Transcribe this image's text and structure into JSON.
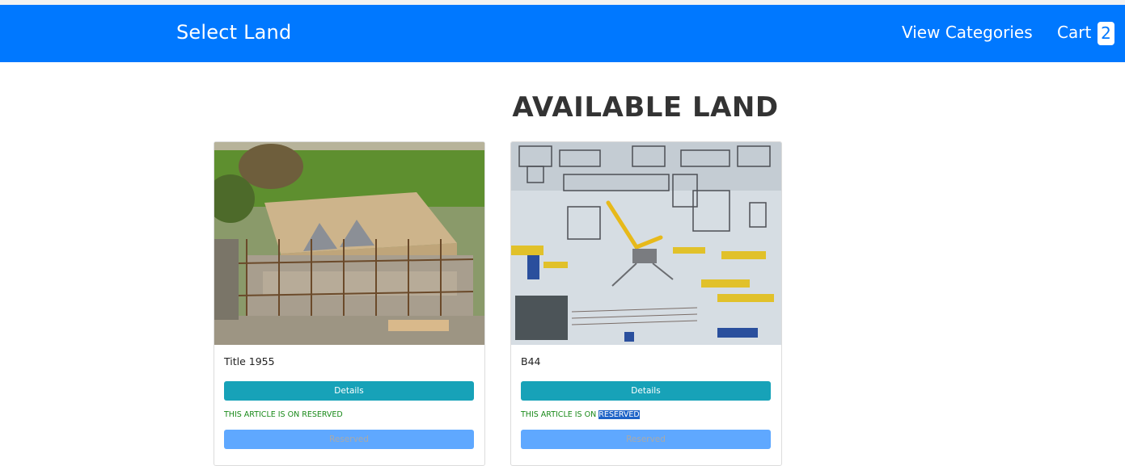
{
  "navbar": {
    "brand": "Select Land",
    "links": [
      {
        "label": "View Categories"
      },
      {
        "label": "Cart"
      }
    ],
    "cart_count": "2",
    "background": "#0078ff"
  },
  "page": {
    "title": "AVAILABLE LAND"
  },
  "cards": [
    {
      "title": "Title 1955",
      "details_label": "Details",
      "note": "THIS ARTICLE IS ON RESERVED",
      "reserved_label": "Reserved",
      "image": "house-construction-photo"
    },
    {
      "title": "B44",
      "details_label": "Details",
      "note_prefix": "THIS ARTICLE IS ON ",
      "note_highlight": "RESERVED",
      "reserved_label": "Reserved",
      "image": "construction-site-photo"
    }
  ],
  "colors": {
    "details_button": "#17a2b8",
    "reserved_button": "#5fa8ff",
    "note_text": "#1a8a1a"
  }
}
